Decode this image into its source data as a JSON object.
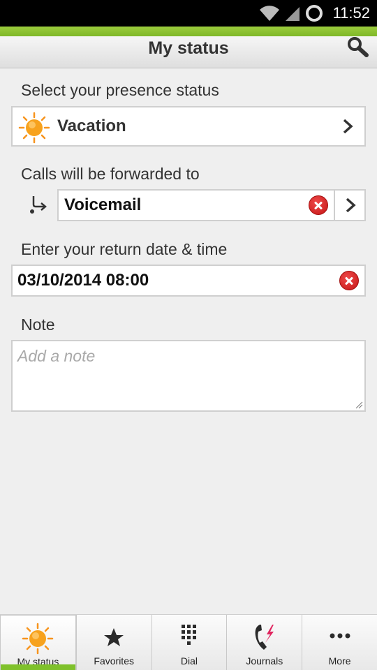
{
  "status_bar": {
    "time": "11:52"
  },
  "header": {
    "title": "My status"
  },
  "presence": {
    "label": "Select your presence status",
    "value": "Vacation",
    "icon": "sun-icon"
  },
  "forwarding": {
    "label": "Calls will be forwarded to",
    "value": "Voicemail"
  },
  "return_time": {
    "label": "Enter your return date & time",
    "value": "03/10/2014 08:00"
  },
  "note": {
    "label": "Note",
    "placeholder": "Add a note"
  },
  "nav": {
    "items": [
      {
        "label": "My status",
        "icon": "sun-icon",
        "active": true
      },
      {
        "label": "Favorites",
        "icon": "star-icon",
        "active": false
      },
      {
        "label": "Dial",
        "icon": "dialpad-icon",
        "active": false
      },
      {
        "label": "Journals",
        "icon": "journal-phone-icon",
        "active": false
      },
      {
        "label": "More",
        "icon": "more-icon",
        "active": false
      }
    ]
  },
  "colors": {
    "accent_green": "#7fc12b",
    "clear_red": "#d41e1e",
    "sun_orange": "#f7941d",
    "journals_red": "#e0245e"
  }
}
